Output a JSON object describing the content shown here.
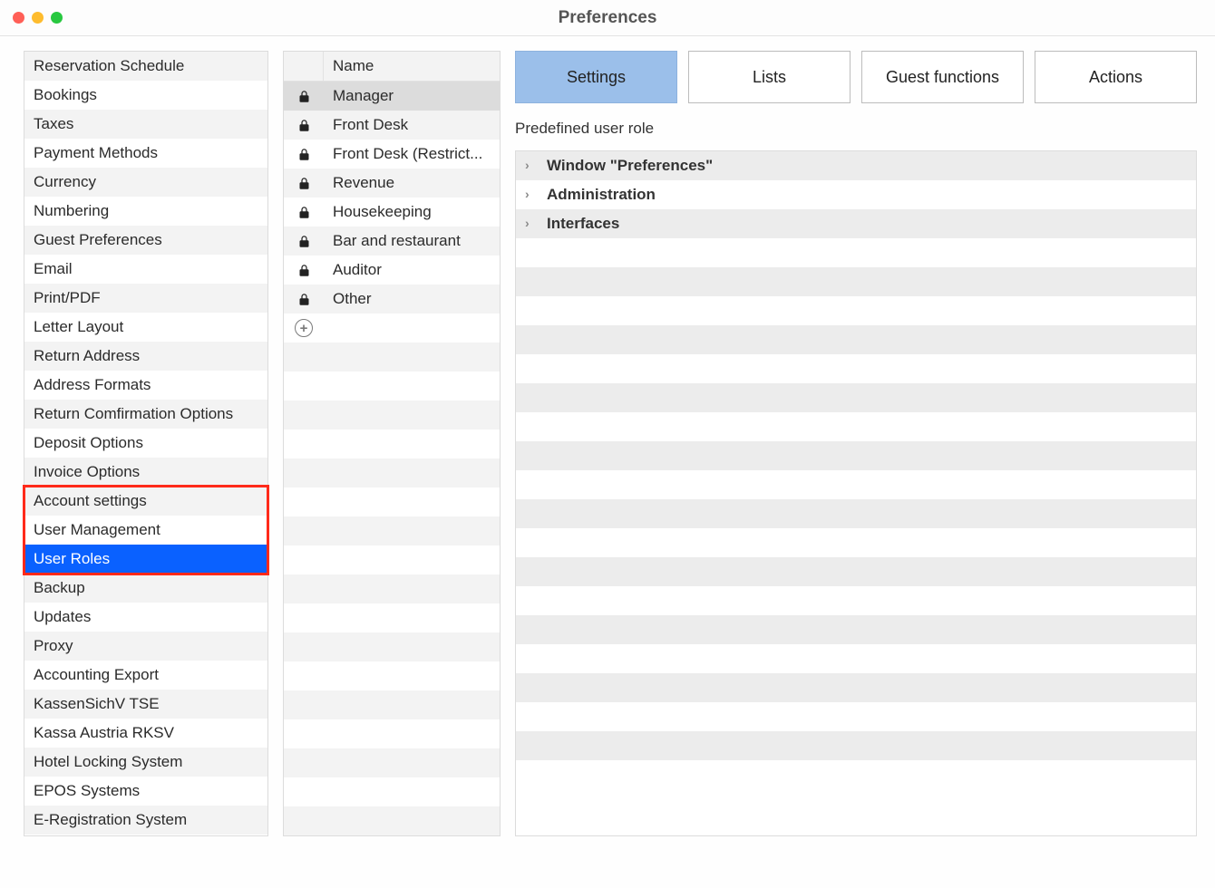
{
  "window": {
    "title": "Preferences"
  },
  "sidebar": {
    "items": [
      "Reservation Schedule",
      "Bookings",
      "Taxes",
      "Payment Methods",
      "Currency",
      "Numbering",
      "Guest Preferences",
      "Email",
      "Print/PDF",
      "Letter Layout",
      "Return Address",
      "Address Formats",
      "Return Comfirmation Options",
      "Deposit Options",
      "Invoice Options",
      "Account settings",
      "User Management",
      "User Roles",
      "Backup",
      "Updates",
      "Proxy",
      "Accounting Export",
      "KassenSichV TSE",
      "Kassa Austria RKSV",
      "Hotel Locking System",
      "EPOS Systems",
      "E-Registration System"
    ],
    "selected_index": 17,
    "highlighted_range": [
      15,
      17
    ]
  },
  "roles": {
    "header": "Name",
    "items": [
      "Manager",
      "Front Desk",
      "Front Desk (Restrict...",
      "Revenue",
      "Housekeeping",
      "Bar and restaurant",
      "Auditor",
      "Other"
    ],
    "selected_index": 0
  },
  "tabs": {
    "items": [
      "Settings",
      "Lists",
      "Guest functions",
      "Actions"
    ],
    "active_index": 0
  },
  "detail": {
    "section_label": "Predefined user role",
    "permissions": [
      "Window \"Preferences\"",
      "Administration",
      "Interfaces"
    ],
    "blank_row_count": 18
  }
}
